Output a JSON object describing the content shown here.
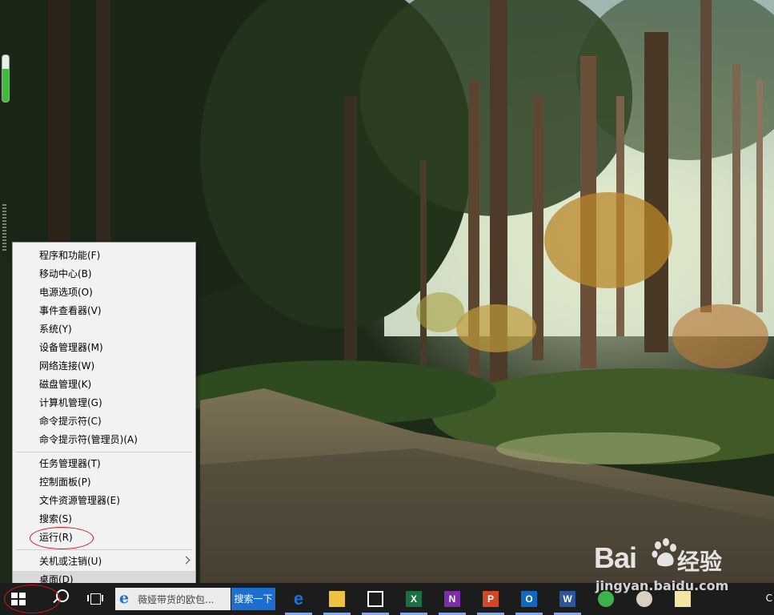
{
  "menu": {
    "items": [
      {
        "label": "程序和功能(F)"
      },
      {
        "label": "移动中心(B)"
      },
      {
        "label": "电源选项(O)"
      },
      {
        "label": "事件查看器(V)"
      },
      {
        "label": "系统(Y)"
      },
      {
        "label": "设备管理器(M)"
      },
      {
        "label": "网络连接(W)"
      },
      {
        "label": "磁盘管理(K)"
      },
      {
        "label": "计算机管理(G)"
      },
      {
        "label": "命令提示符(C)"
      },
      {
        "label": "命令提示符(管理员)(A)"
      },
      {
        "label": "任务管理器(T)"
      },
      {
        "label": "控制面板(P)"
      },
      {
        "label": "文件资源管理器(E)"
      },
      {
        "label": "搜索(S)"
      },
      {
        "label": "运行(R)"
      },
      {
        "label": "关机或注销(U)"
      },
      {
        "label": "桌面(D)"
      }
    ]
  },
  "taskbar": {
    "search_box_text": "薇娅带货的欧包...",
    "search_button_label": "搜索一下",
    "apps": [
      {
        "icon": "edge-icon",
        "letter": "e",
        "color": "#1a73d9"
      },
      {
        "icon": "file-explorer-icon",
        "letter": "",
        "color": "#f0c040"
      },
      {
        "icon": "store-icon",
        "letter": "",
        "color": "#ffffff"
      },
      {
        "icon": "excel-icon",
        "letter": "X",
        "color": "#1d7044"
      },
      {
        "icon": "onenote-icon",
        "letter": "N",
        "color": "#7b2fa6"
      },
      {
        "icon": "powerpoint-icon",
        "letter": "P",
        "color": "#d24726"
      },
      {
        "icon": "outlook-icon",
        "letter": "O",
        "color": "#1068c2"
      },
      {
        "icon": "word-icon",
        "letter": "W",
        "color": "#2b579a"
      },
      {
        "icon": "refresh-app-icon",
        "letter": "",
        "color": "#3bb34a"
      },
      {
        "icon": "paint-icon",
        "letter": "",
        "color": "#d8d0c0"
      },
      {
        "icon": "notes-icon",
        "letter": "",
        "color": "#f3e6a5"
      }
    ],
    "clock_fragment": "C"
  },
  "gadget": {
    "level_percent": 70
  },
  "watermark": {
    "brand": "Bai",
    "brand_suffix": "经验",
    "url": "jingyan.baidu.com"
  },
  "colors": {
    "annotation_circle": "#e01010",
    "highlight": "#d9d9d9"
  }
}
